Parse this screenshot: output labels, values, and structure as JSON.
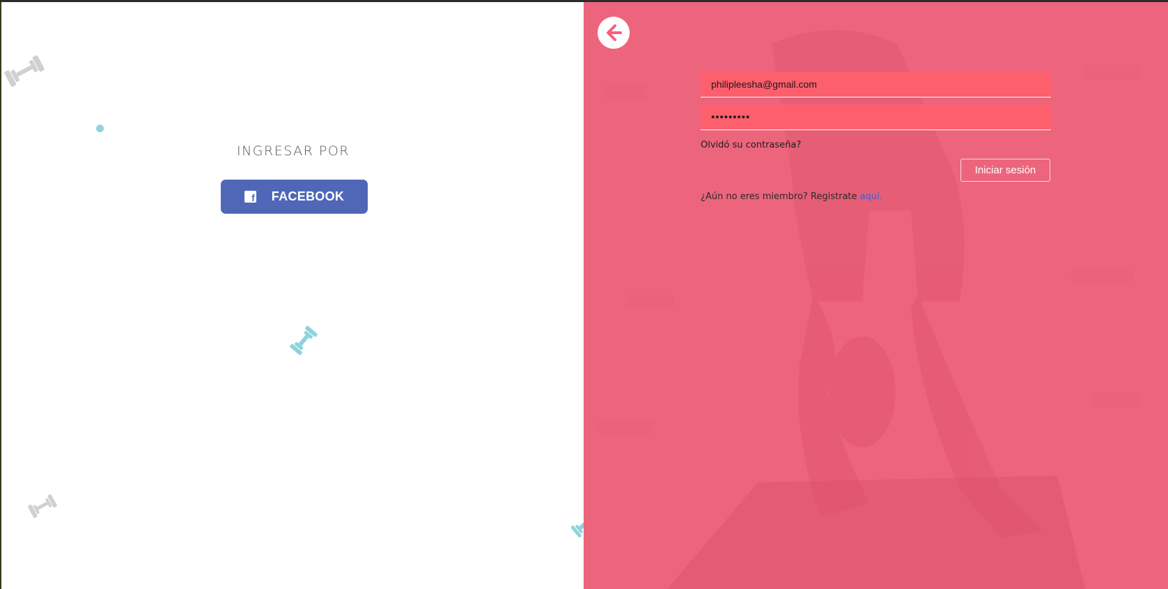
{
  "colors": {
    "facebook_blue": "#5067b8",
    "pink_overlay": "#f4607c",
    "input_fill": "#fd5f6d",
    "link_blue": "#3b62d6",
    "decor_teal": "#8fd3dc",
    "decor_gray": "#cfcfcf"
  },
  "left_panel": {
    "heading": "INGRESAR POR",
    "facebook_button": {
      "label": "FACEBOOK",
      "icon": "facebook-icon"
    },
    "decorations": [
      "dumbbell-icon",
      "dot",
      "dumbbell-icon",
      "dumbbell-icon",
      "dumbbell-icon"
    ]
  },
  "right_panel": {
    "back_icon": "arrow-left-icon",
    "email_value": "philipleesha@gmail.com",
    "password_value": "•••••••••",
    "forgot_link": "Olvidó su contraseña?",
    "login_button": "Iniciar sesión",
    "register_text": "¿Aún no eres miembro? Registrate ",
    "register_link": "aquí."
  }
}
